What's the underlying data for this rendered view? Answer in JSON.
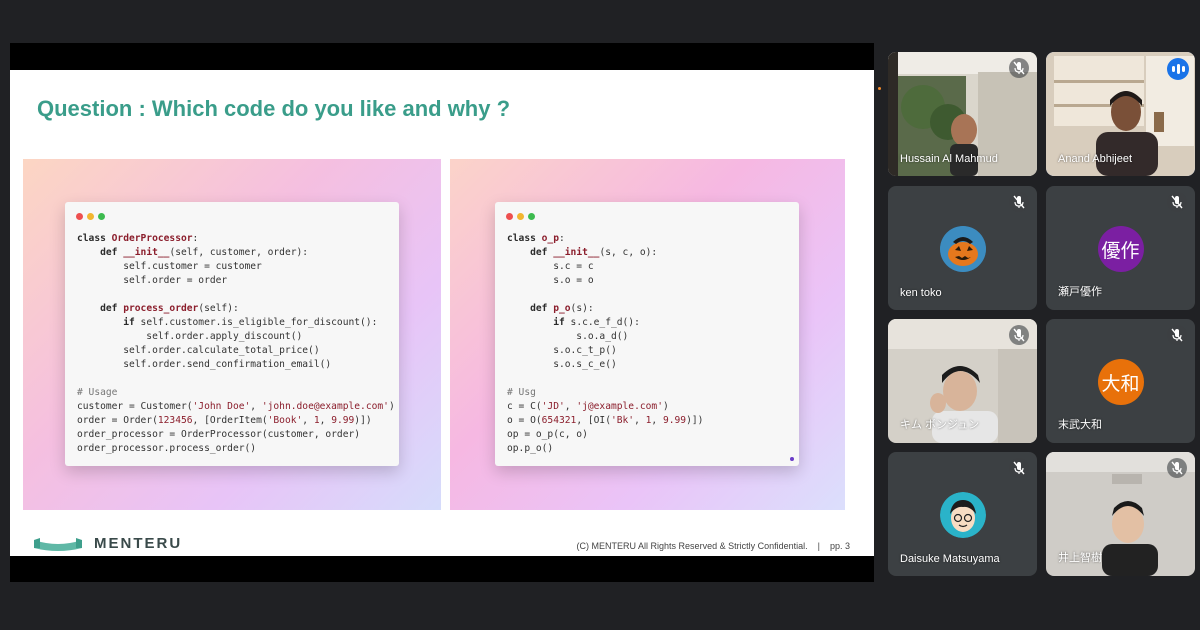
{
  "slide": {
    "title": "Question : Which code do you like and why ?",
    "left_code": [
      [
        {
          "t": "class ",
          "c": "kw"
        },
        {
          "t": "OrderProcessor",
          "c": "nm"
        },
        {
          "t": ":",
          "c": ""
        }
      ],
      [
        {
          "t": "    def ",
          "c": "kw"
        },
        {
          "t": "__init__",
          "c": "nm"
        },
        {
          "t": "(self, customer, order):",
          "c": ""
        }
      ],
      [
        {
          "t": "        self.customer = customer",
          "c": ""
        }
      ],
      [
        {
          "t": "        self.order = order",
          "c": ""
        }
      ],
      [
        {
          "t": "",
          "c": ""
        }
      ],
      [
        {
          "t": "    def ",
          "c": "kw"
        },
        {
          "t": "process_order",
          "c": "nm"
        },
        {
          "t": "(self):",
          "c": ""
        }
      ],
      [
        {
          "t": "        if ",
          "c": "kw"
        },
        {
          "t": "self.customer.is_eligible_for_discount():",
          "c": ""
        }
      ],
      [
        {
          "t": "            self.order.apply_discount()",
          "c": ""
        }
      ],
      [
        {
          "t": "        self.order.calculate_total_price()",
          "c": ""
        }
      ],
      [
        {
          "t": "        self.order.send_confirmation_email()",
          "c": ""
        }
      ],
      [
        {
          "t": "",
          "c": ""
        }
      ],
      [
        {
          "t": "# Usage",
          "c": "cm"
        }
      ],
      [
        {
          "t": "customer = Customer(",
          "c": ""
        },
        {
          "t": "'John Doe'",
          "c": "st"
        },
        {
          "t": ", ",
          "c": ""
        },
        {
          "t": "'john.doe@example.com'",
          "c": "st"
        },
        {
          "t": ")",
          "c": ""
        }
      ],
      [
        {
          "t": "order = Order(",
          "c": ""
        },
        {
          "t": "123456",
          "c": "nu"
        },
        {
          "t": ", [OrderItem(",
          "c": ""
        },
        {
          "t": "'Book'",
          "c": "st"
        },
        {
          "t": ", ",
          "c": ""
        },
        {
          "t": "1",
          "c": "nu"
        },
        {
          "t": ", ",
          "c": ""
        },
        {
          "t": "9.99",
          "c": "nu"
        },
        {
          "t": ")])",
          "c": ""
        }
      ],
      [
        {
          "t": "order_processor = OrderProcessor(customer, order)",
          "c": ""
        }
      ],
      [
        {
          "t": "order_processor.process_order()",
          "c": ""
        }
      ]
    ],
    "right_code": [
      [
        {
          "t": "class ",
          "c": "kw"
        },
        {
          "t": "o_p",
          "c": "nm"
        },
        {
          "t": ":",
          "c": ""
        }
      ],
      [
        {
          "t": "    def ",
          "c": "kw"
        },
        {
          "t": "__init__",
          "c": "nm"
        },
        {
          "t": "(s, c, o):",
          "c": ""
        }
      ],
      [
        {
          "t": "        s.c = c",
          "c": ""
        }
      ],
      [
        {
          "t": "        s.o = o",
          "c": ""
        }
      ],
      [
        {
          "t": "",
          "c": ""
        }
      ],
      [
        {
          "t": "    def ",
          "c": "kw"
        },
        {
          "t": "p_o",
          "c": "nm"
        },
        {
          "t": "(s):",
          "c": ""
        }
      ],
      [
        {
          "t": "        if ",
          "c": "kw"
        },
        {
          "t": "s.c.e_f_d():",
          "c": ""
        }
      ],
      [
        {
          "t": "            s.o.a_d()",
          "c": ""
        }
      ],
      [
        {
          "t": "        s.o.c_t_p()",
          "c": ""
        }
      ],
      [
        {
          "t": "        s.o.s_c_e()",
          "c": ""
        }
      ],
      [
        {
          "t": "",
          "c": ""
        }
      ],
      [
        {
          "t": "# Usg",
          "c": "cm"
        }
      ],
      [
        {
          "t": "c = C(",
          "c": ""
        },
        {
          "t": "'JD'",
          "c": "st"
        },
        {
          "t": ", ",
          "c": ""
        },
        {
          "t": "'j@example.com'",
          "c": "st"
        },
        {
          "t": ")",
          "c": ""
        }
      ],
      [
        {
          "t": "o = O(",
          "c": ""
        },
        {
          "t": "654321",
          "c": "nu"
        },
        {
          "t": ", [OI(",
          "c": ""
        },
        {
          "t": "'Bk'",
          "c": "st"
        },
        {
          "t": ", ",
          "c": ""
        },
        {
          "t": "1",
          "c": "nu"
        },
        {
          "t": ", ",
          "c": ""
        },
        {
          "t": "9.99",
          "c": "nu"
        },
        {
          "t": ")])",
          "c": ""
        }
      ],
      [
        {
          "t": "op = o_p(c, o)",
          "c": ""
        }
      ],
      [
        {
          "t": "op.p_o()",
          "c": ""
        }
      ]
    ],
    "logo_text": "MENTERU",
    "copyright": "(C) MENTERU All Rights Reserved & Strictly Confidential.",
    "separator": "|",
    "page": "pp. 3"
  },
  "participants": [
    {
      "name": "Hussain Al Mahmud",
      "type": "video",
      "muted": true
    },
    {
      "name": "Anand Abhijeet",
      "type": "video",
      "speaking": true
    },
    {
      "name": "ken toko",
      "type": "avatar",
      "muted": true,
      "icon": "pumpkin-avatar"
    },
    {
      "name": "瀬戸優作",
      "type": "initials",
      "initials": "優作",
      "color": "#7b1fa2",
      "muted": true
    },
    {
      "name": "キム ボンジュン",
      "type": "video",
      "muted": true
    },
    {
      "name": "末武大和",
      "type": "initials",
      "initials": "大和",
      "color": "#e8710a",
      "muted": true
    },
    {
      "name": "Daisuke Matsuyama",
      "type": "avatar",
      "muted": true,
      "icon": "cartoon-face-avatar"
    },
    {
      "name": "井上智樹",
      "type": "video",
      "muted": true
    }
  ],
  "colors": {
    "title": "#3a9d8a",
    "background": "#202124",
    "tile": "#3c4043",
    "active_border": "#8ab4f8"
  }
}
